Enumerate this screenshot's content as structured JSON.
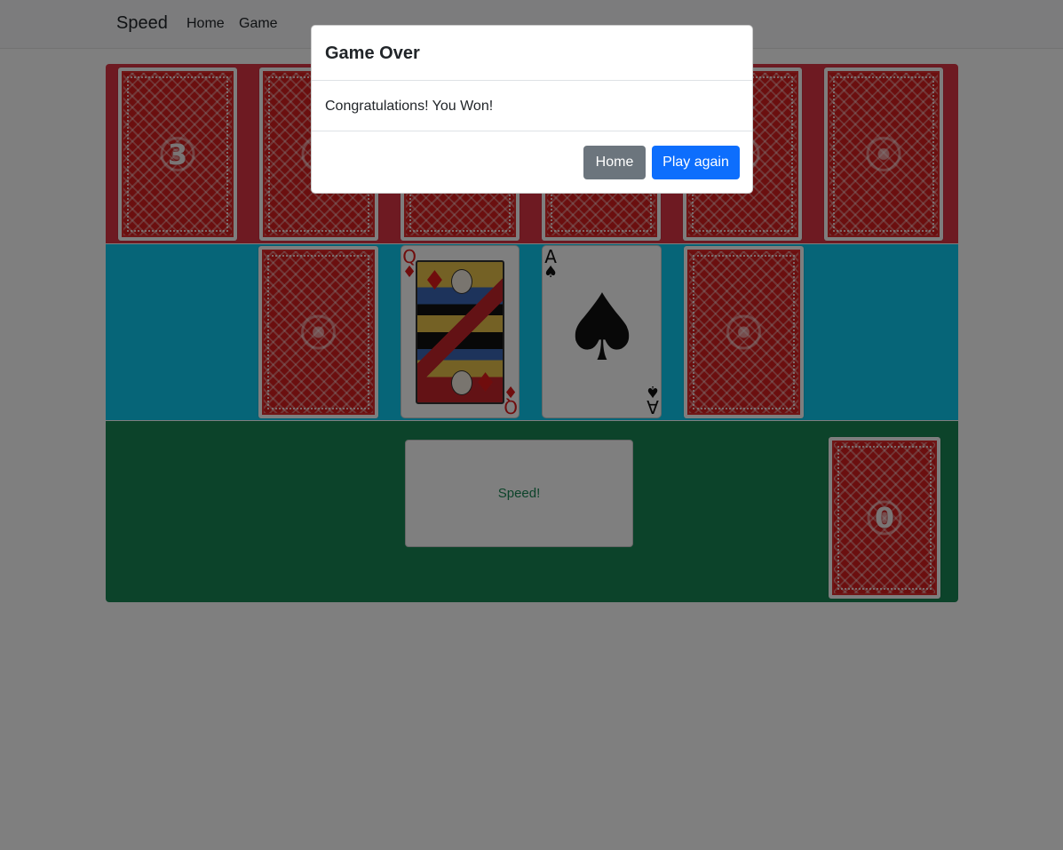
{
  "navbar": {
    "brand": "Speed",
    "links": [
      {
        "label": "Home"
      },
      {
        "label": "Game"
      }
    ]
  },
  "colors": {
    "opponent_row": "#dc3545",
    "center_row": "#0dcaf0",
    "player_row": "#198754",
    "card_back": "#d61f1f",
    "speed_text": "#198754",
    "btn_home": "#6c757d",
    "btn_play": "#0d6efd"
  },
  "game": {
    "opponent": {
      "draw_pile_count": "3",
      "hand_cards": 5
    },
    "center": {
      "left_pile": "card-back",
      "left_play_card": {
        "rank": "Q",
        "suit": "♦",
        "color": "red"
      },
      "right_play_card": {
        "rank": "A",
        "suit": "♠",
        "color": "black"
      },
      "right_pile": "card-back"
    },
    "player": {
      "speed_button_label": "Speed!",
      "draw_pile_count": "0"
    }
  },
  "modal": {
    "title": "Game Over",
    "message": "Congratulations! You Won!",
    "buttons": {
      "home": "Home",
      "play_again": "Play again"
    }
  }
}
